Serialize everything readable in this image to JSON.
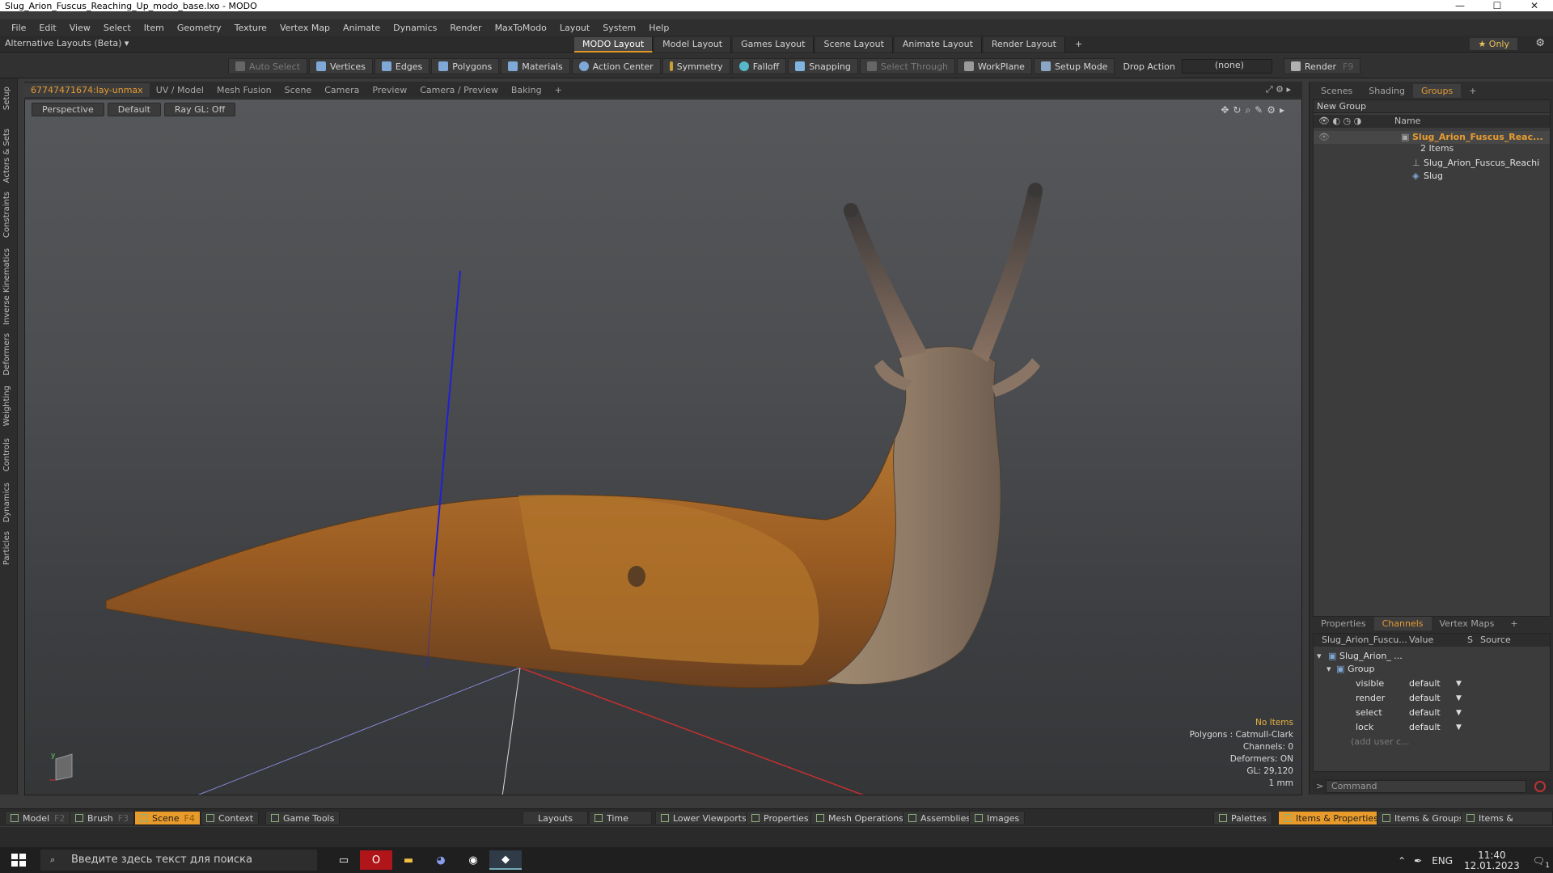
{
  "window": {
    "title": "Slug_Arion_Fuscus_Reaching_Up_modo_base.lxo - MODO",
    "min": "—",
    "max": "☐",
    "close": "✕"
  },
  "menu": [
    "File",
    "Edit",
    "View",
    "Select",
    "Item",
    "Geometry",
    "Texture",
    "Vertex Map",
    "Animate",
    "Dynamics",
    "Render",
    "MaxToModo",
    "Layout",
    "System",
    "Help"
  ],
  "layouts": {
    "alt_label": "Alternative Layouts (Beta) ▾",
    "tabs": [
      "MODO Layout",
      "Model Layout",
      "Games Layout",
      "Scene Layout",
      "Animate Layout",
      "Render Layout"
    ],
    "active": "MODO Layout",
    "plus": "+",
    "only": "★ Only"
  },
  "toolbar": {
    "auto_select": "Auto Select",
    "vertices": "Vertices",
    "edges": "Edges",
    "polygons": "Polygons",
    "materials": "Materials",
    "action_center": "Action Center",
    "symmetry": "Symmetry",
    "falloff": "Falloff",
    "snapping": "Snapping",
    "select_through": "Select Through",
    "workplane": "WorkPlane",
    "setup_mode": "Setup Mode",
    "drop_action": "Drop Action",
    "drop_value": "(none)",
    "render": "Render",
    "render_key": "F9"
  },
  "left_strip": [
    "Setup",
    "Actors & Sets",
    "Constraints",
    "Inverse Kinematics",
    "Deformers",
    "Weighting",
    "Controls",
    "Dynamics",
    "Particles"
  ],
  "viewport_tabs": {
    "tabs": [
      "67747471674:lay-unmax",
      "UV / Model",
      "Mesh Fusion",
      "Scene",
      "Camera",
      "Preview",
      "Camera / Preview",
      "Baking",
      "+"
    ],
    "active": "67747471674:lay-unmax"
  },
  "viewport": {
    "view": "Perspective",
    "shading": "Default",
    "raygl": "Ray GL: Off",
    "info": {
      "no_items": "No Items",
      "polygons": "Polygons : Catmull-Clark",
      "channels": "Channels: 0",
      "deformers": "Deformers: ON",
      "gl": "GL: 29,120",
      "unit": "1 mm"
    }
  },
  "right_panel": {
    "top_tabs": [
      "Scenes",
      "Shading",
      "Groups",
      "+"
    ],
    "active_top": "Groups",
    "new_group": "New Group",
    "name_header": "Name",
    "group_name": "Slug_Arion_Fuscus_Reac...",
    "group_count": "2 Items",
    "children": [
      "Slug_Arion_Fuscus_Reachi ...",
      "Slug"
    ],
    "bottom_tabs": [
      "Properties",
      "Channels",
      "Vertex Maps",
      "+"
    ],
    "active_bottom": "Channels",
    "ch_headers": {
      "name": "Slug_Arion_Fuscu...",
      "value": "Value",
      "s": "S",
      "source": "Source"
    },
    "ch_item": "Slug_Arion_ ...",
    "ch_group": "Group",
    "ch_rows": [
      {
        "name": "visible",
        "value": "default"
      },
      {
        "name": "render",
        "value": "default"
      },
      {
        "name": "select",
        "value": "default"
      },
      {
        "name": "lock",
        "value": "default"
      }
    ],
    "add_user": "(add user c...",
    "command_placeholder": "Command"
  },
  "bottom_bar": {
    "left": [
      {
        "label": "Model",
        "key": "F2"
      },
      {
        "label": "Brush",
        "key": "F3"
      },
      {
        "label": "Scene",
        "key": "F4"
      },
      {
        "label": "Context",
        "key": ""
      },
      {
        "label": "Game Tools",
        "key": ""
      }
    ],
    "active_left": "Scene",
    "middle": [
      "Layouts",
      "Time",
      "Lower Viewports",
      "Properties",
      "Mesh Operations",
      "Assemblies",
      "Images"
    ],
    "right": [
      "Palettes",
      "Items & Properties",
      "Items & Groups",
      "Items & Shading"
    ],
    "active_right": "Items & Properties"
  },
  "taskbar": {
    "search_placeholder": "Введите здесь текст для поиска",
    "lang": "ENG",
    "time": "11:40",
    "date": "12.01.2023",
    "notif_count": "1"
  }
}
